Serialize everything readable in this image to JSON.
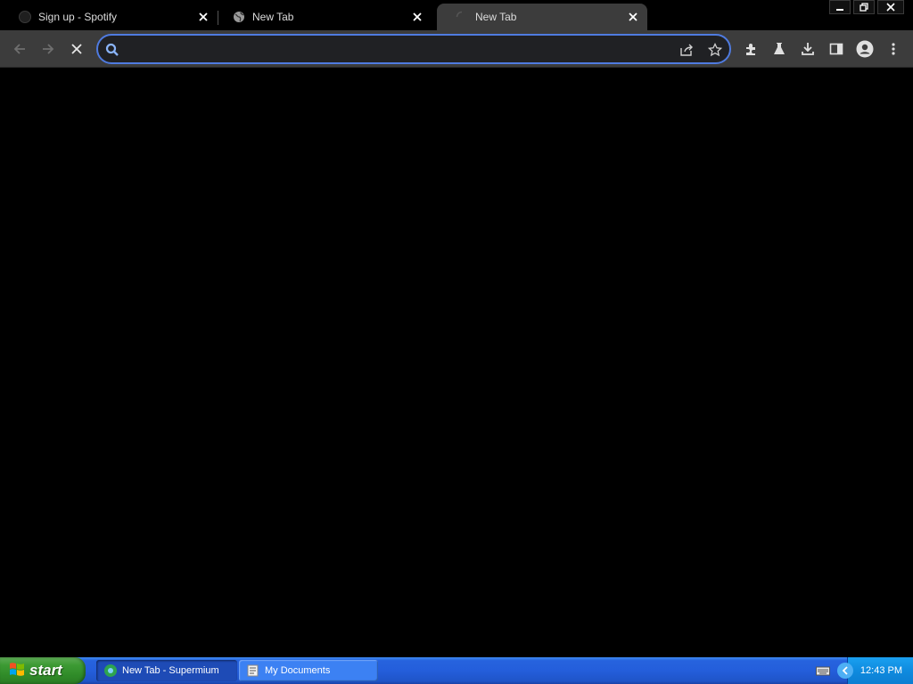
{
  "browser": {
    "tabs": [
      {
        "title": "Sign up - Spotify",
        "favicon": "spotify-icon",
        "active": false
      },
      {
        "title": "New Tab",
        "favicon": "globe-icon",
        "active": false
      },
      {
        "title": "New Tab",
        "favicon": "loading-spinner-icon",
        "active": true
      }
    ],
    "omnibox": {
      "value": "",
      "placeholder": ""
    },
    "colors": {
      "toolbar": "#3c3c3c",
      "omnibox_border": "#4f7be0",
      "background": "#000000"
    }
  },
  "taskbar": {
    "start_label": "start",
    "buttons": [
      {
        "label": "New Tab - Supermium",
        "icon": "supermium-icon",
        "active": true
      },
      {
        "label": "My Documents",
        "icon": "folder-icon",
        "active": false
      }
    ],
    "clock": "12:43 PM"
  }
}
